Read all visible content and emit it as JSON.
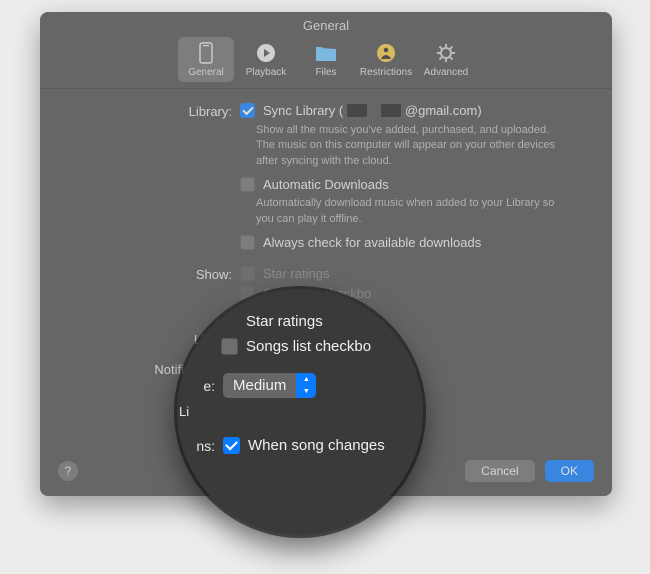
{
  "window": {
    "title": "General"
  },
  "toolbar": {
    "items": [
      {
        "label": "General"
      },
      {
        "label": "Playback"
      },
      {
        "label": "Files"
      },
      {
        "label": "Restrictions"
      },
      {
        "label": "Advanced"
      }
    ]
  },
  "library": {
    "label": "Library:",
    "sync_label": "Sync Library (",
    "sync_suffix": "@gmail.com)",
    "help": "Show all the music you've added, purchased, and uploaded. The music on this computer will appear on your other devices after syncing with the cloud.",
    "auto_label": "Automatic Downloads",
    "auto_help": "Automatically download music when added to your Library so you can play it offline.",
    "check_label": "Always check for available downloads"
  },
  "show": {
    "label": "Show:",
    "star_label": "Star ratings",
    "songs_label": "Songs list checkbo"
  },
  "size": {
    "label_fragment_left": "e:",
    "li_fragment": "Li",
    "value": "Medium"
  },
  "notifications": {
    "label_left": "Notifi",
    "label_right": "ns:",
    "when_label": "When song changes"
  },
  "footer": {
    "cancel": "Cancel",
    "ok": "OK"
  }
}
